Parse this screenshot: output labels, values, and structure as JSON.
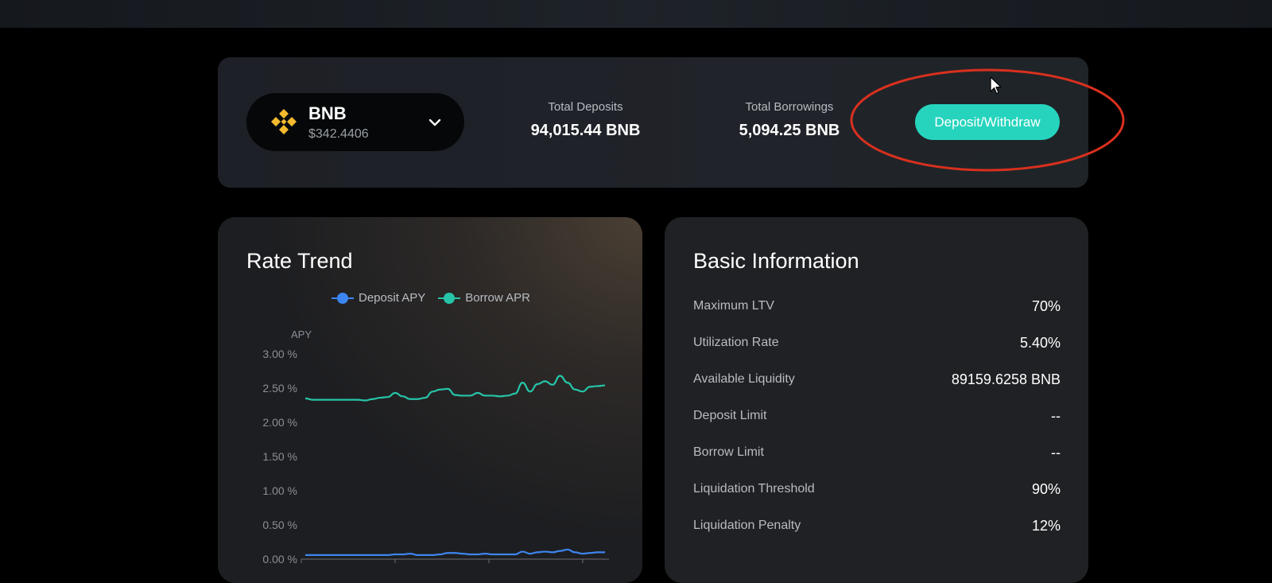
{
  "asset": {
    "symbol": "BNB",
    "price": "$342.4406"
  },
  "stats": {
    "deposits_label": "Total Deposits",
    "deposits_value": "94,015.44 BNB",
    "borrowings_label": "Total Borrowings",
    "borrowings_value": "5,094.25 BNB"
  },
  "action_button": "Deposit/Withdraw",
  "rate_trend": {
    "title": "Rate Trend",
    "legend": [
      "Deposit APY",
      "Borrow APR"
    ]
  },
  "chart_data": {
    "type": "line",
    "title": "Rate Trend",
    "ylabel": "APY",
    "xlabel": "",
    "y_ticks": [
      "0.00 %",
      "0.50 %",
      "1.00 %",
      "1.50 %",
      "2.00 %",
      "2.50 %",
      "3.00 %"
    ],
    "ylim": [
      0,
      3.0
    ],
    "x_index": [
      0,
      1,
      2,
      3,
      4,
      5,
      6,
      7,
      8,
      9,
      10,
      11,
      12,
      13,
      14,
      15,
      16,
      17,
      18,
      19,
      20,
      21,
      22,
      23,
      24,
      25,
      26,
      27,
      28,
      29,
      30,
      31,
      32,
      33,
      34,
      35,
      36,
      37,
      38,
      39,
      40
    ],
    "series": [
      {
        "name": "Deposit APY",
        "color": "#3d85f0",
        "values": [
          0.06,
          0.06,
          0.06,
          0.06,
          0.06,
          0.06,
          0.06,
          0.06,
          0.06,
          0.06,
          0.06,
          0.06,
          0.07,
          0.07,
          0.08,
          0.06,
          0.06,
          0.06,
          0.07,
          0.09,
          0.09,
          0.08,
          0.07,
          0.07,
          0.08,
          0.07,
          0.07,
          0.07,
          0.07,
          0.11,
          0.08,
          0.1,
          0.11,
          0.1,
          0.12,
          0.14,
          0.1,
          0.08,
          0.09,
          0.1,
          0.1
        ]
      },
      {
        "name": "Borrow APR",
        "color": "#26c4a8",
        "values": [
          2.35,
          2.33,
          2.33,
          2.33,
          2.33,
          2.33,
          2.33,
          2.33,
          2.32,
          2.34,
          2.36,
          2.37,
          2.43,
          2.38,
          2.34,
          2.34,
          2.36,
          2.45,
          2.48,
          2.49,
          2.4,
          2.39,
          2.39,
          2.43,
          2.39,
          2.39,
          2.38,
          2.39,
          2.42,
          2.58,
          2.45,
          2.56,
          2.6,
          2.55,
          2.68,
          2.58,
          2.48,
          2.45,
          2.52,
          2.53,
          2.54
        ]
      }
    ],
    "grid": false,
    "legend_position": "top"
  },
  "basic_info": {
    "title": "Basic Information",
    "rows": [
      {
        "label": "Maximum LTV",
        "value": "70%"
      },
      {
        "label": "Utilization Rate",
        "value": "5.40%"
      },
      {
        "label": "Available Liquidity",
        "value": "89159.6258 BNB"
      },
      {
        "label": "Deposit Limit",
        "value": "--"
      },
      {
        "label": "Borrow Limit",
        "value": "--"
      },
      {
        "label": "Liquidation Threshold",
        "value": "90%"
      },
      {
        "label": "Liquidation Penalty",
        "value": "12%"
      }
    ]
  },
  "colors": {
    "accent": "#26d4bd",
    "bnb_yellow": "#f3ba2f",
    "highlight": "#d9301e"
  }
}
